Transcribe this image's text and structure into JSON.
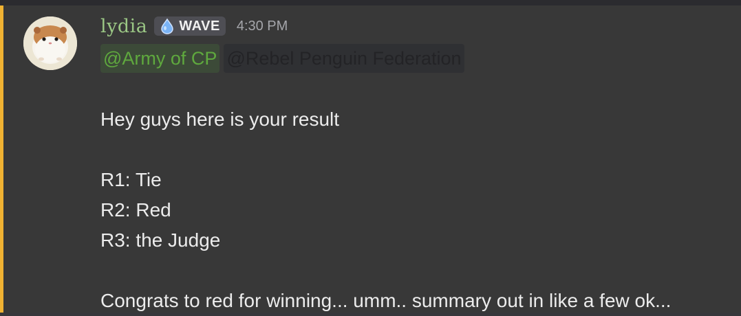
{
  "message": {
    "author": "lydia",
    "tag": {
      "label": "WAVE",
      "icon": "water-drop-icon",
      "color": "#7ab3f5"
    },
    "timestamp": "4:30 PM",
    "mentions": [
      "@Army of CP",
      "@Rebel Penguin Federation"
    ],
    "lines": [
      "Hey guys here is your result",
      "",
      "R1: Tie",
      "R2: Red",
      "R3: the Judge",
      "",
      "Congrats to red for winning... umm.. summary out in like a few ok..."
    ]
  },
  "colors": {
    "background": "#383838",
    "highlight_bar": "#f0b232",
    "username": "#9bc785",
    "mention_green": "#5fa93e"
  }
}
